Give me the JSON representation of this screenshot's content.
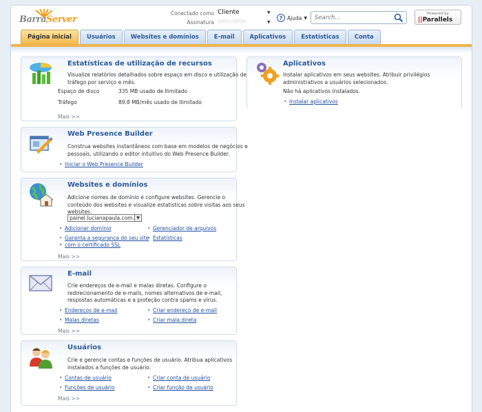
{
  "header": {
    "logo_barra": "Barra",
    "logo_server": "Server",
    "connected_label": "Conectado como",
    "connected_user": "Cliente",
    "subscription_label": "Assinatura",
    "subscription_value": "subscription",
    "help_label": "Ajuda",
    "search_placeholder": "Search...",
    "powered_by": "Powered by",
    "parallels": "Parallels"
  },
  "tabs": [
    {
      "label": "Página inicial",
      "active": true
    },
    {
      "label": "Usuários"
    },
    {
      "label": "Websites e domínios"
    },
    {
      "label": "E-mail"
    },
    {
      "label": "Aplicativos"
    },
    {
      "label": "Estatísticas"
    },
    {
      "label": "Conta"
    }
  ],
  "stats": {
    "title": "Estatísticas de utilização de recursos",
    "description": "Visualize relatórios detalhados sobre espaço em disco e utilização de tráfego por serviço e mês.",
    "disk_label": "Espaço de disco",
    "disk_value": "335 MB usado de Ilimitado",
    "traffic_label": "Tráfego",
    "traffic_value": "89.8 MB/mês usado de Ilimitado",
    "more": "Mais >>"
  },
  "builder": {
    "title": "Web Presence Builder",
    "description": "Construa websites instantâneos com base em modelos de negócios e pessoais, utilizando o editor intuitivo do Web Presence Builder.",
    "link": "Iniciar o Web Presence Builder"
  },
  "websites": {
    "title": "Websites e domínios",
    "description": "Adicione nomes de domínio e configure websites. Gerencie o conteúdo dos websites e visualize estatísticas sobre visitas aos seus websites.",
    "domain_selected": "painel.lucianapaula.com.br",
    "link_add_domain": "Adicionar domínio",
    "link_file_manager": "Gerenciador de arquivos",
    "link_ssl_1": "Garanta a segurança do seu site",
    "link_ssl_2": "com o certificado SSL",
    "link_stats": "Estatísticas",
    "more": "Mais >>"
  },
  "email": {
    "title": "E-mail",
    "description": "Crie endereços de e-mail e malas diretas. Configure o redirecionamento de e-mails, nomes alternativos de e-mail, respostas automáticas e a proteção contra spams e vírus.",
    "link_addresses": "Endereços de e-mail",
    "link_create_address": "Criar endereço de e-mail",
    "link_mailing": "Malas diretas",
    "link_create_mailing": "Criar mala direta",
    "more": "Mais >>"
  },
  "users": {
    "title": "Usuários",
    "description": "Crie e gerencie contas e funções de usuário. Atribua aplicativos instalados a funções de usuário.",
    "link_accounts": "Contas de usuário",
    "link_create_account": "Criar conta de usuário",
    "link_roles": "Funções de usuário",
    "link_create_role": "Criar função de usuário",
    "more": "Mais >>"
  },
  "apps": {
    "title": "Aplicativos",
    "description": "Instalar aplicativos em seus websites. Atribuir privilégios administrativos a usuários selecionados.",
    "none": "Não há aplicativos instalados.",
    "link_install": "Instalar aplicativos"
  }
}
